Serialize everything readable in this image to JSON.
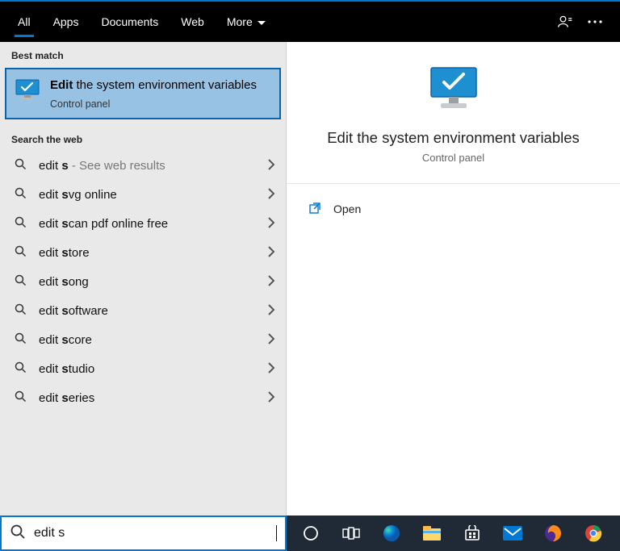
{
  "tabs": {
    "all": "All",
    "apps": "Apps",
    "documents": "Documents",
    "web": "Web",
    "more": "More"
  },
  "sections": {
    "best_match": "Best match",
    "search_web": "Search the web"
  },
  "best_match": {
    "title_bold": "Edit",
    "title_rest": " the system environment variables",
    "subtitle": "Control panel"
  },
  "web_results": [
    {
      "pre": "edit ",
      "bold": "s",
      "rest": "",
      "hint": " - See web results"
    },
    {
      "pre": "edit ",
      "bold": "s",
      "rest": "vg online",
      "hint": ""
    },
    {
      "pre": "edit ",
      "bold": "s",
      "rest": "can pdf online free",
      "hint": ""
    },
    {
      "pre": "edit ",
      "bold": "s",
      "rest": "tore",
      "hint": ""
    },
    {
      "pre": "edit ",
      "bold": "s",
      "rest": "ong",
      "hint": ""
    },
    {
      "pre": "edit ",
      "bold": "s",
      "rest": "oftware",
      "hint": ""
    },
    {
      "pre": "edit ",
      "bold": "s",
      "rest": "core",
      "hint": ""
    },
    {
      "pre": "edit ",
      "bold": "s",
      "rest": "tudio",
      "hint": ""
    },
    {
      "pre": "edit ",
      "bold": "s",
      "rest": "eries",
      "hint": ""
    }
  ],
  "preview": {
    "title": "Edit the system environment variables",
    "subtitle": "Control panel"
  },
  "actions": {
    "open": "Open"
  },
  "search": {
    "value": "edit s"
  },
  "taskbar_icons": [
    "cortana",
    "taskview",
    "edge",
    "explorer",
    "store",
    "mail",
    "firefox",
    "chrome",
    "app-t"
  ]
}
